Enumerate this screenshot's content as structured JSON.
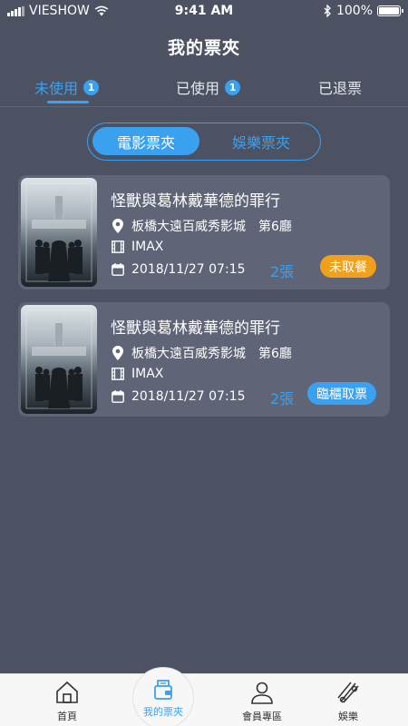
{
  "status_bar": {
    "carrier": "VIESHOW",
    "time": "9:41 AM",
    "battery": "100%",
    "battery_level": 1.0
  },
  "header": {
    "title": "我的票夾"
  },
  "tabs": [
    {
      "label": "未使用",
      "badge": "1",
      "active": true
    },
    {
      "label": "已使用",
      "badge": "1",
      "active": false
    },
    {
      "label": "已退票",
      "badge": "",
      "active": false
    }
  ],
  "segment": {
    "options": [
      {
        "label": "電影票夾",
        "active": true
      },
      {
        "label": "娛樂票夾",
        "active": false
      }
    ]
  },
  "tickets": [
    {
      "title": "怪獸與葛林戴華德的罪行",
      "location": "板橋大遠百威秀影城　第6廳",
      "format": "IMAX",
      "datetime": "2018/11/27 07:15",
      "quantity": "2張",
      "action_label": "未取餐",
      "action_color": "#f2a01c"
    },
    {
      "title": "怪獸與葛林戴華德的罪行",
      "location": "板橋大遠百威秀影城　第6廳",
      "format": "IMAX",
      "datetime": "2018/11/27 07:15",
      "quantity": "2張",
      "action_label": "臨櫃取票",
      "action_color": "#3aa0f0"
    }
  ],
  "bottom_nav": [
    {
      "label": "首頁",
      "icon": "home-icon"
    },
    {
      "label": "我的票夾",
      "icon": "ticket-wallet-icon",
      "active": true
    },
    {
      "label": "會員專區",
      "icon": "user-icon"
    },
    {
      "label": "娛樂",
      "icon": "entertainment-icon"
    }
  ],
  "colors": {
    "accent": "#3aa0f0",
    "background": "#4d5263",
    "card": "#5f6476",
    "warning": "#f2a01c"
  }
}
